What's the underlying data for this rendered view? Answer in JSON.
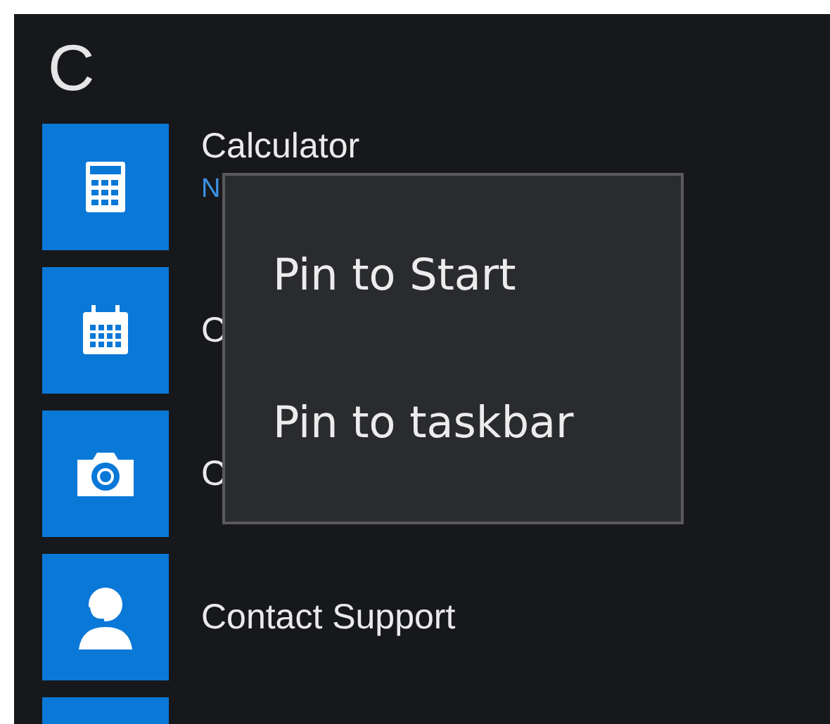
{
  "section": {
    "letter": "C"
  },
  "apps": [
    {
      "kind": "calculator",
      "name": "Calculator",
      "subtitle": "N"
    },
    {
      "kind": "calendar",
      "name": "C"
    },
    {
      "kind": "camera",
      "name": "C"
    },
    {
      "kind": "support",
      "name": "Contact Support"
    },
    {
      "kind": "blank"
    }
  ],
  "context_menu": {
    "items": [
      "Pin to Start",
      "Pin to taskbar"
    ]
  }
}
